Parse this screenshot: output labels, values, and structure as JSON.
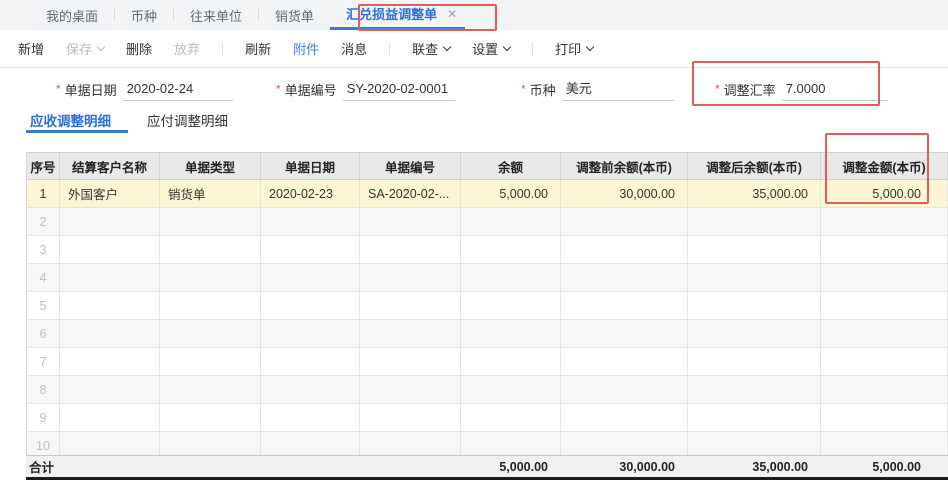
{
  "colors": {
    "accent_blue": "#2e70d8",
    "tab_underline_blue": "#3a7bd5",
    "link_blue": "#4080d9",
    "annotation_red": "#e05d5d",
    "required_asterisk": "#e0507a",
    "row_highlight_yellow": "#fcf6d5",
    "header_gray": "#e9e9ea",
    "footer_gray": "#f1f1f2"
  },
  "tabbar": {
    "tabs": [
      {
        "label": "我的桌面",
        "active": false
      },
      {
        "label": "币种",
        "active": false
      },
      {
        "label": "往来单位",
        "active": false
      },
      {
        "label": "销货单",
        "active": false
      },
      {
        "label": "汇兑损益调整单",
        "active": true
      }
    ],
    "close_icon": "✕"
  },
  "toolbar": {
    "items": [
      {
        "label": "新增",
        "state": "normal",
        "dropdown": false
      },
      {
        "label": "保存",
        "state": "disabled",
        "dropdown": true
      },
      {
        "label": "删除",
        "state": "normal",
        "dropdown": false
      },
      {
        "label": "放弃",
        "state": "disabled",
        "dropdown": false
      },
      {
        "label": "刷新",
        "state": "normal",
        "dropdown": false
      },
      {
        "label": "附件",
        "state": "link",
        "dropdown": false
      },
      {
        "label": "消息",
        "state": "normal",
        "dropdown": false
      },
      {
        "label": "联查",
        "state": "normal",
        "dropdown": true
      },
      {
        "label": "设置",
        "state": "normal",
        "dropdown": true
      },
      {
        "label": "打印",
        "state": "normal",
        "dropdown": true
      }
    ]
  },
  "form": {
    "required_mark": "*",
    "fields": [
      {
        "label": "单据日期",
        "value": "2020-02-24",
        "required": true
      },
      {
        "label": "单据编号",
        "value": "SY-2020-02-0001",
        "required": true
      },
      {
        "label": "币种",
        "value": "美元",
        "required": true
      },
      {
        "label": "调整汇率",
        "value": "7.0000",
        "required": true,
        "highlighted": true
      }
    ]
  },
  "subtabs": [
    {
      "label": "应收调整明细",
      "active": true
    },
    {
      "label": "应付调整明细",
      "active": false
    }
  ],
  "grid": {
    "columns": [
      "序号",
      "结算客户名称",
      "单据类型",
      "单据日期",
      "单据编号",
      "余额",
      "调整前余额(本币)",
      "调整后余额(本币)",
      "调整金额(本币)"
    ],
    "rows": [
      {
        "seq": "1",
        "customer": "外国客户",
        "doc_type": "销货单",
        "doc_date": "2020-02-23",
        "doc_no": "SA-2020-02-...",
        "balance": "5,000.00",
        "before_local": "30,000.00",
        "after_local": "35,000.00",
        "adjust_local": "5,000.00"
      }
    ],
    "empty_row_numbers": [
      "2",
      "3",
      "4",
      "5",
      "6",
      "7",
      "8",
      "9",
      "10"
    ],
    "footer": {
      "label": "合计",
      "balance": "5,000.00",
      "before_local": "30,000.00",
      "after_local": "35,000.00",
      "adjust_local": "5,000.00"
    }
  }
}
